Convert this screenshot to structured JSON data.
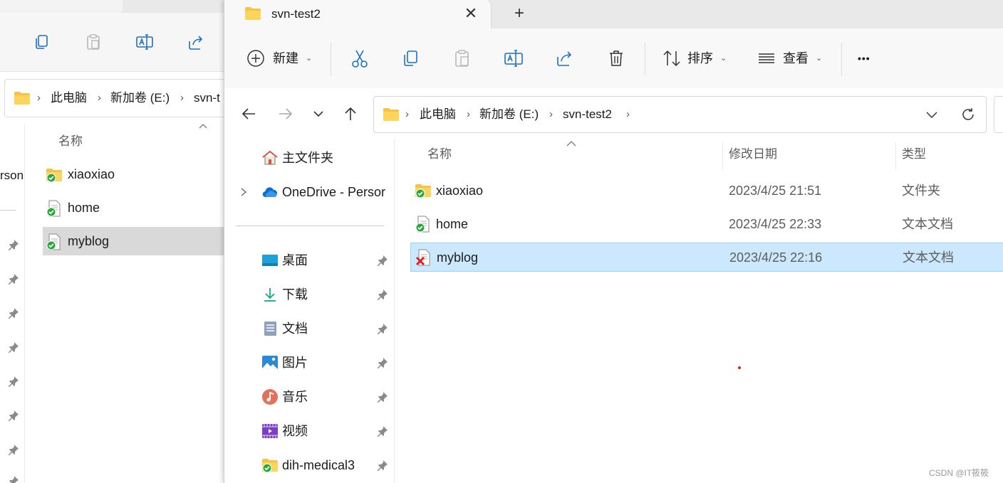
{
  "background_window": {
    "breadcrumb": [
      "此电脑",
      "新加卷 (E:)",
      "svn-t"
    ],
    "nav_partial_label": "rson",
    "column_name": "名称",
    "files": [
      {
        "name": "xiaoxiao",
        "icon": "svn-folder-ok-icon"
      },
      {
        "name": "home",
        "icon": "svn-file-ok-icon"
      },
      {
        "name": "myblog",
        "icon": "svn-file-ok-icon"
      }
    ]
  },
  "main_window": {
    "tab": {
      "title": "svn-test2",
      "close": "✕",
      "new_tab": "+"
    },
    "toolbar": {
      "new_label": "新建",
      "sort_label": "排序",
      "view_label": "查看",
      "more": "•••"
    },
    "breadcrumb": [
      "此电脑",
      "新加卷 (E:)",
      "svn-test2"
    ],
    "nav_pane": {
      "home": "主文件夹",
      "onedrive": "OneDrive - Persor",
      "pinned": [
        {
          "label": "桌面",
          "icon": "desktop-icon"
        },
        {
          "label": "下载",
          "icon": "download-icon"
        },
        {
          "label": "文档",
          "icon": "documents-icon"
        },
        {
          "label": "图片",
          "icon": "pictures-icon"
        },
        {
          "label": "音乐",
          "icon": "music-icon"
        },
        {
          "label": "视频",
          "icon": "videos-icon"
        },
        {
          "label": "dih-medical3",
          "icon": "svn-folder-ok-icon"
        }
      ]
    },
    "columns": {
      "name": "名称",
      "modified": "修改日期",
      "type": "类型"
    },
    "files": [
      {
        "name": "xiaoxiao",
        "modified": "2023/4/25 21:51",
        "type": "文件夹",
        "status": "normal"
      },
      {
        "name": "home",
        "modified": "2023/4/25 22:33",
        "type": "文本文档",
        "status": "normal"
      },
      {
        "name": "myblog",
        "modified": "2023/4/25 22:16",
        "type": "文本文档",
        "status": "conflict",
        "selected": true
      }
    ]
  },
  "watermark": "CSDN @IT筱筱",
  "colors": {
    "selection": "#cce8ff",
    "selection_border": "#99d1ff",
    "folder": "#f6c344",
    "svn_ok": "#2aa83b",
    "svn_conflict": "#d9231f",
    "accent": "#0067c0"
  }
}
